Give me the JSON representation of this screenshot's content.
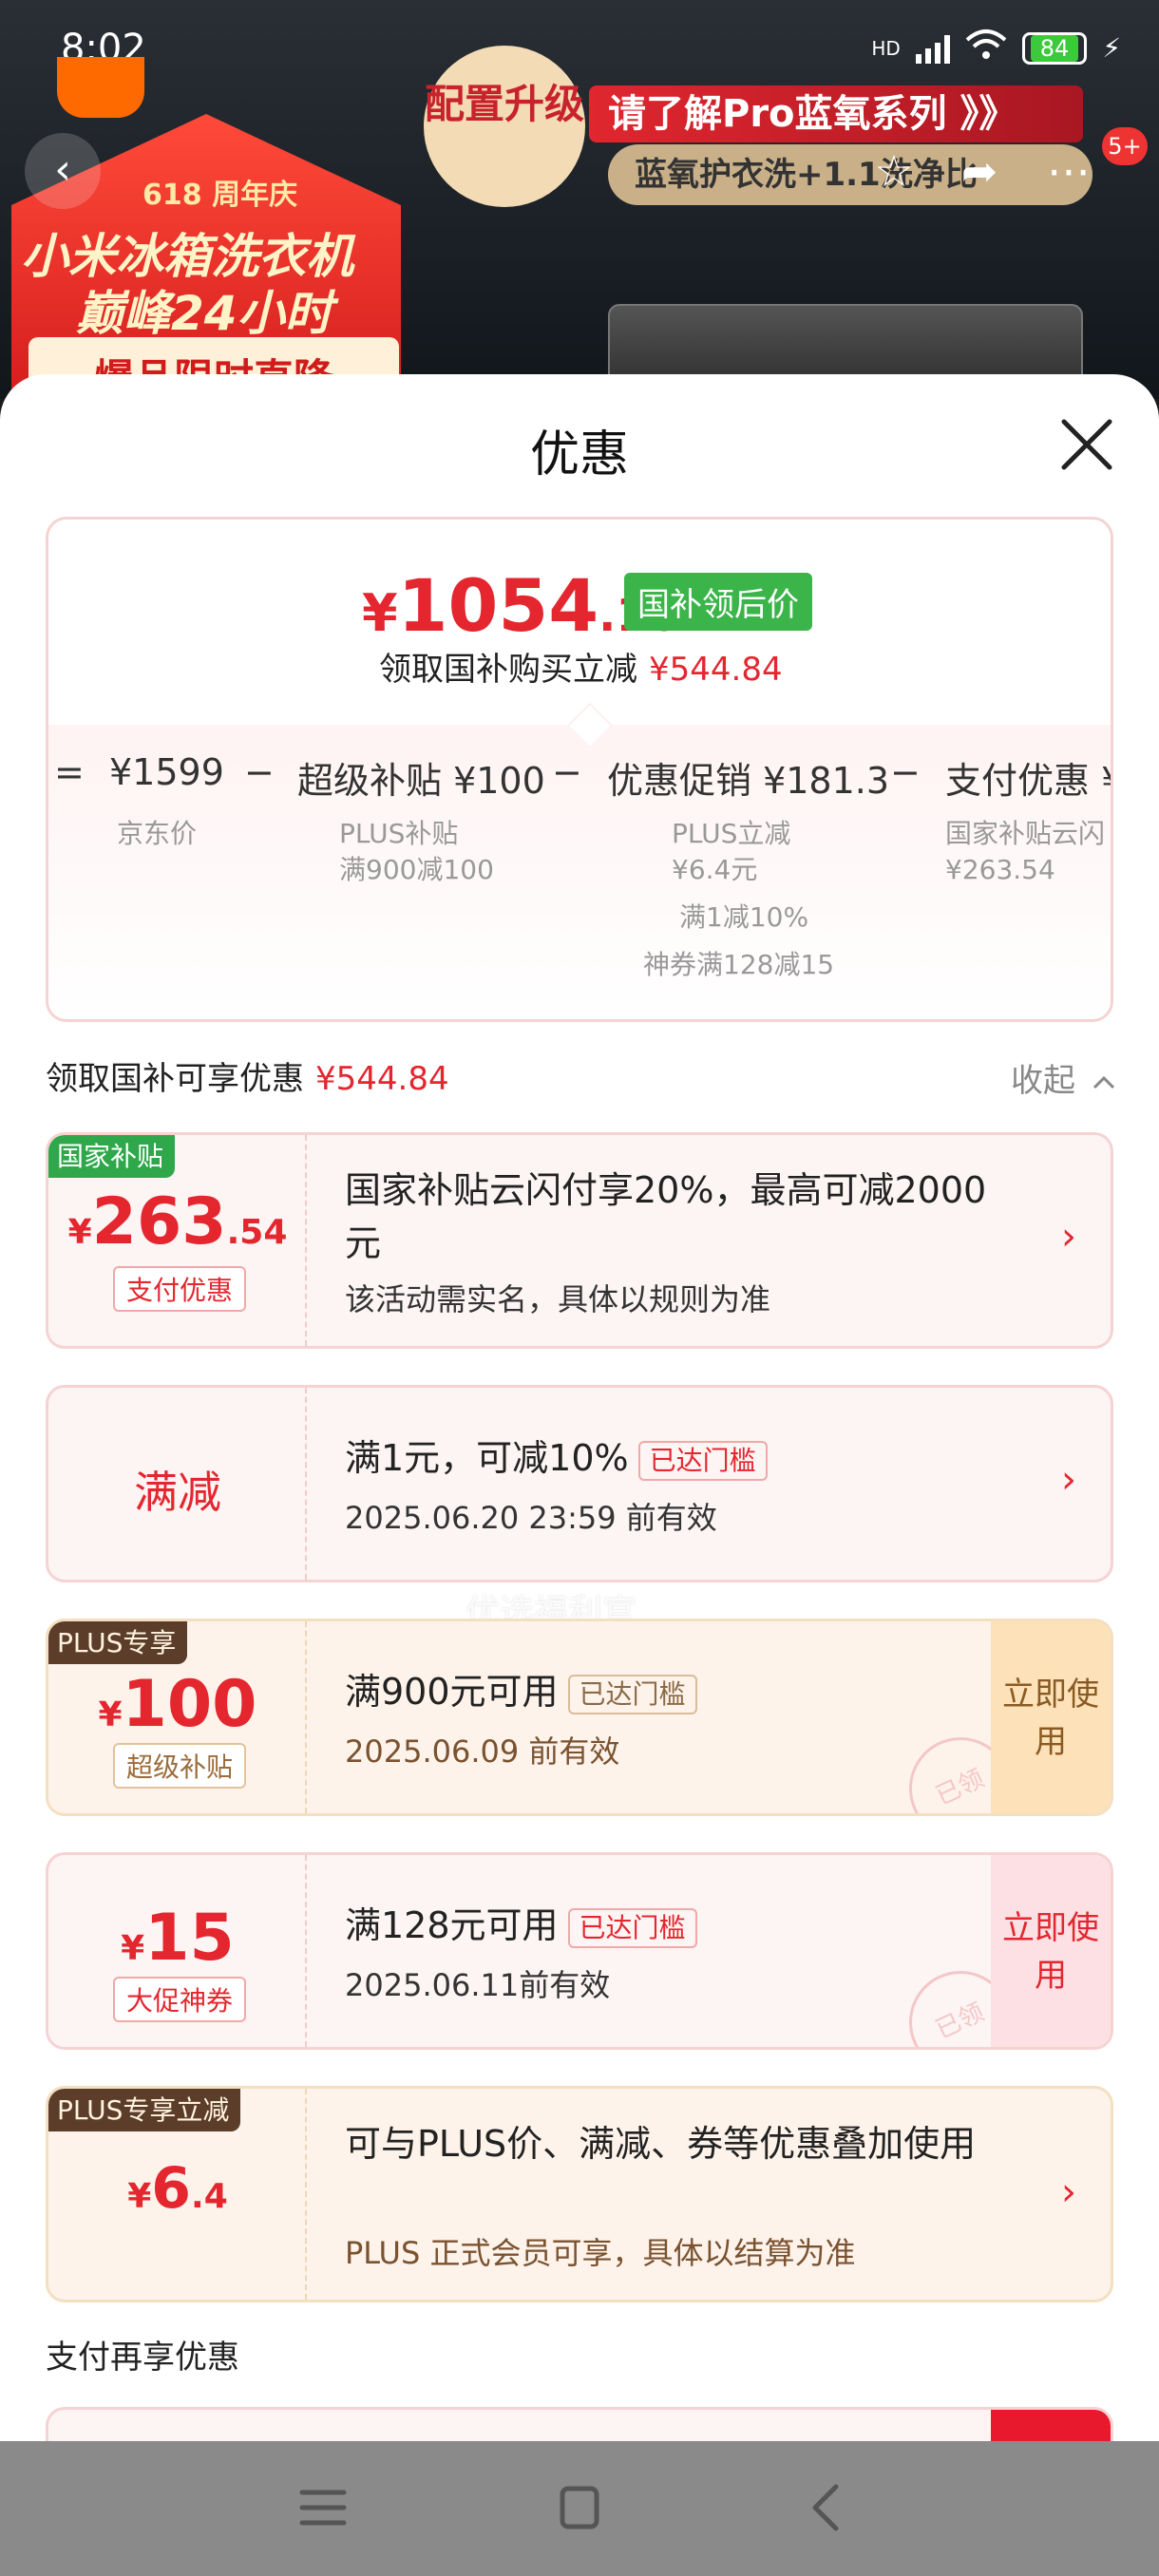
{
  "status": {
    "time": "8:02",
    "network": "HD",
    "battery": "84"
  },
  "banner": {
    "anniversary": "618 周年庆",
    "promo_line1": "小米冰箱洗衣机",
    "promo_line2": "巅峰24小时",
    "promo_line3": "爆品限时直降",
    "config_badge": "配置升级",
    "title": "请了解Pro蓝氧系列 》》",
    "subtitle": "蓝氧护衣洗+1.1洗净比",
    "message_count": "5+"
  },
  "sheet": {
    "title": "优惠",
    "final_price": {
      "currency": "¥",
      "integer": "1054",
      "decimal": ".16",
      "tag": "国补领后价"
    },
    "final_note": {
      "text": "领取国补购买立减",
      "amount": "¥544.84"
    },
    "calc": {
      "equals": "=",
      "items": [
        {
          "main": "¥1599",
          "sub": [
            "京东价"
          ]
        },
        {
          "main": "超级补贴 ¥100",
          "sub": [
            "PLUS补贴",
            "满900减100"
          ]
        },
        {
          "main": "优惠促销 ¥181.3",
          "sub": [
            "PLUS立减",
            "¥6.4元",
            "满1减10%",
            "神券满128减15"
          ]
        },
        {
          "main": "支付优惠 ¥",
          "sub": [
            "国家补贴云闪",
            "¥263.54"
          ]
        }
      ],
      "minus": "−"
    },
    "section1": {
      "label": "领取国补可享优惠",
      "amount": "¥544.84",
      "collapse": "收起"
    },
    "coupons": [
      {
        "tag": "国家补贴",
        "currency": "¥",
        "amount": "263",
        "decimal": ".54",
        "sub_tag": "支付优惠",
        "title": "国家补贴云闪付享20%，最高可减2000元",
        "desc": "该活动需实名，具体以规则为准"
      },
      {
        "label": "满减",
        "title": "满1元，可减10%",
        "threshold": "已达门槛",
        "desc": "2025.06.20 23:59 前有效"
      },
      {
        "tag": "PLUS专享",
        "currency": "¥",
        "amount": "100",
        "sub_tag": "超级补贴",
        "title": "满900元可用",
        "threshold": "已达门槛",
        "desc": "2025.06.09 前有效",
        "button": "立即使用",
        "stamp": "已领"
      },
      {
        "currency": "¥",
        "amount": "15",
        "sub_tag": "大促神券",
        "title": "满128元可用",
        "threshold": "已达门槛",
        "desc": "2025.06.11前有效",
        "button": "立即使用",
        "stamp": "已领"
      },
      {
        "tag": "PLUS专享立减",
        "currency": "¥",
        "amount": "6",
        "decimal": ".4",
        "title": "可与PLUS价、满减、券等优惠叠加使用",
        "desc": "PLUS 正式会员可享，具体以结算为准"
      }
    ],
    "watermark": "优选福利官",
    "section2": {
      "label": "支付再享优惠"
    }
  },
  "colors": {
    "accent_red": "#e4262f",
    "national_green": "#2ea84a",
    "plus_brown": "#5b3d2a"
  }
}
